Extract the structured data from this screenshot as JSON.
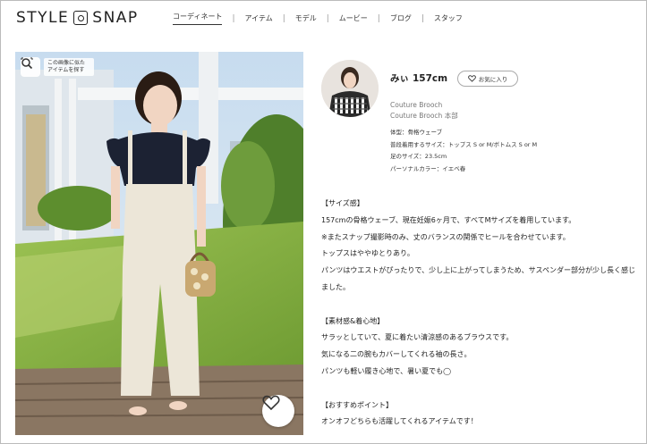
{
  "header": {
    "logo_left": "STYLE",
    "logo_right": "SNAP",
    "nav": [
      "コーディネート",
      "アイテム",
      "モデル",
      "ムービー",
      "ブログ",
      "スタッフ"
    ],
    "nav_separator": "|"
  },
  "photo": {
    "similar_label_line1": "この画像に似た",
    "similar_label_line2": "アイテムを探す"
  },
  "profile": {
    "name": "みぃ",
    "height": "157cm",
    "favorite_label": "お気に入り",
    "shop_line1": "Couture Brooch",
    "shop_line2": "Couture Brooch 本部",
    "specs": [
      "体型：骨格ウェーブ",
      "普段着用するサイズ：トップス S or M/ボトムス S or M",
      "足のサイズ：23.5cm",
      "パーソナルカラー：イエベ春"
    ]
  },
  "comment": {
    "size_heading": "【サイズ感】",
    "size_lines": [
      "157cmの骨格ウェーブ、現在妊娠6ヶ月で、すべてMサイズを着用しています。",
      "※またスナップ撮影時のみ、丈のバランスの関係でヒールを合わせています。",
      "トップスはややゆとりあり。",
      "パンツはウエストがぴったりで、少し上に上がってしまうため、サスペンダー部分が少し長く感じました。"
    ],
    "material_heading": "【素材感&着心地】",
    "material_lines": [
      "サラッとしていて、夏に着たい清涼感のあるブラウスです。",
      "気になる二の腕もカバーしてくれる袖の長さ。",
      "パンツも軽い履き心地で、暑い夏でも◯"
    ],
    "point_heading": "【おすすめポイント】",
    "point_lines": [
      "オンオフどちらも活躍してくれるアイテムです！"
    ]
  },
  "colors": {
    "sky": "#cfe1f0",
    "grass": "#7fae3c",
    "deck": "#8a7662",
    "blouse": "#1c2233",
    "pants": "#ece6d8"
  }
}
